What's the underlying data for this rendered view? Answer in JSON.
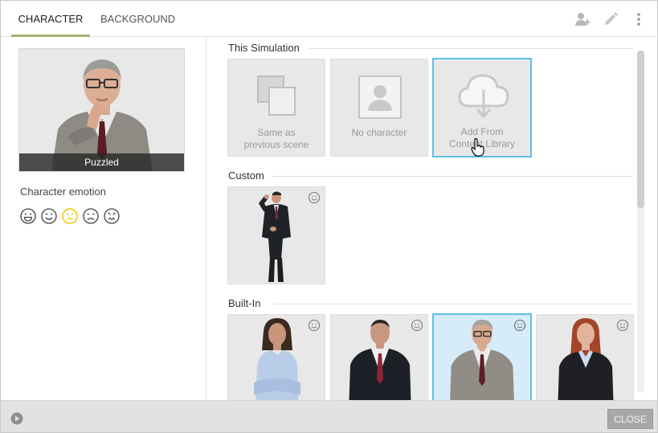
{
  "tabs": [
    {
      "label": "CHARACTER",
      "active": true
    },
    {
      "label": "BACKGROUND",
      "active": false
    }
  ],
  "header_icons": [
    "add-user-icon",
    "pencil-icon",
    "more-vertical-icon"
  ],
  "preview": {
    "caption": "Puzzled"
  },
  "emotion": {
    "label": "Character emotion",
    "options": [
      "very-happy",
      "happy",
      "puzzled",
      "sad",
      "angry"
    ],
    "selected": "puzzled",
    "selected_color": "#f2c200"
  },
  "sections": {
    "this_simulation": {
      "title": "This Simulation",
      "tiles": [
        {
          "label_line1": "Same as",
          "label_line2": "previous scene",
          "icon": "copy-icon"
        },
        {
          "label_line1": "No character",
          "label_line2": "",
          "icon": "no-character-icon"
        },
        {
          "label_line1": "Add From",
          "label_line2": "Content Library",
          "icon": "cloud-download-icon",
          "selected": true
        }
      ]
    },
    "custom": {
      "title": "Custom",
      "tiles": [
        {
          "character": "man-on-phone"
        }
      ]
    },
    "built_in": {
      "title": "Built-In",
      "tiles": [
        {
          "character": "woman-arms-crossed"
        },
        {
          "character": "man-dark-suit"
        },
        {
          "character": "man-gray-jacket",
          "selected": true
        },
        {
          "character": "woman-red-hair"
        }
      ]
    }
  },
  "footer": {
    "close_label": "CLOSE"
  },
  "colors": {
    "accent": "#a6b26a",
    "selection": "#5bc0e8"
  }
}
